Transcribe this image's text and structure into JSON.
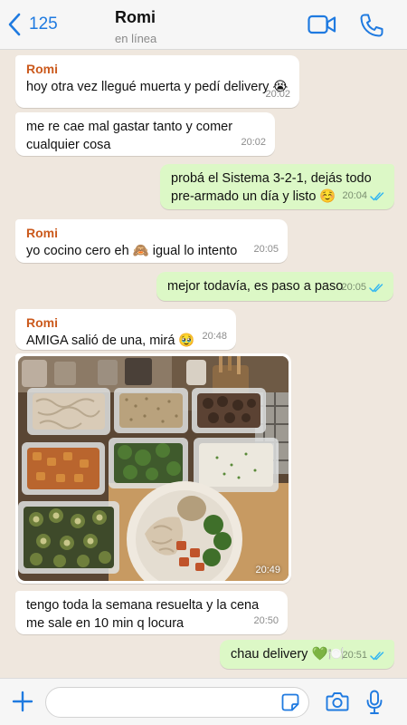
{
  "header": {
    "back_count": "125",
    "contact_name": "Romi",
    "contact_status": "en línea",
    "icons": [
      "chevron-left-icon",
      "video-call-icon",
      "phone-icon"
    ]
  },
  "messages": [
    {
      "from": "Romi",
      "direction": "in",
      "sender": "Romi",
      "text": "hoy otra vez llegué muerta y pedí delivery 😭",
      "time": "20:02"
    },
    {
      "from": "Romi",
      "direction": "in",
      "text": "me re cae mal gastar tanto y comer\ncualquier cosa",
      "time": "20:02"
    },
    {
      "from": "me",
      "direction": "out",
      "text": "probá el Sistema 3-2-1, dejás todo\npre-armado un día y listo ☺️",
      "time": "20:04",
      "status": "read"
    },
    {
      "from": "Romi",
      "direction": "in",
      "sender": "Romi",
      "text": "yo cocino cero eh 🙈 igual lo intento",
      "time": "20:05"
    },
    {
      "from": "me",
      "direction": "out",
      "text": "mejor todavía, es paso a paso",
      "time": "20:05",
      "status": "read"
    },
    {
      "from": "Romi",
      "direction": "in",
      "sender": "Romi",
      "text": "AMIGA salió de una, mirá 🥹",
      "time": "20:48"
    },
    {
      "from": "Romi",
      "direction": "in",
      "type": "photo",
      "time": "20:49"
    },
    {
      "from": "Romi",
      "direction": "in",
      "text": "tengo toda la semana resuelta y la cena\nme sale en 10 min q locura",
      "time": "20:50"
    },
    {
      "from": "me",
      "direction": "out",
      "text": "chau delivery 💚🍽️",
      "time": "20:51",
      "status": "read"
    }
  ],
  "input": {
    "value": "",
    "placeholder": ""
  },
  "colors": {
    "accent": "#1f7ae0",
    "outgoing_bubble": "#dcf8c6",
    "incoming_bubble": "#ffffff",
    "sender_name": "#cb5a1d",
    "read_ticks": "#34b7f1",
    "chat_background": "#efe7de"
  }
}
